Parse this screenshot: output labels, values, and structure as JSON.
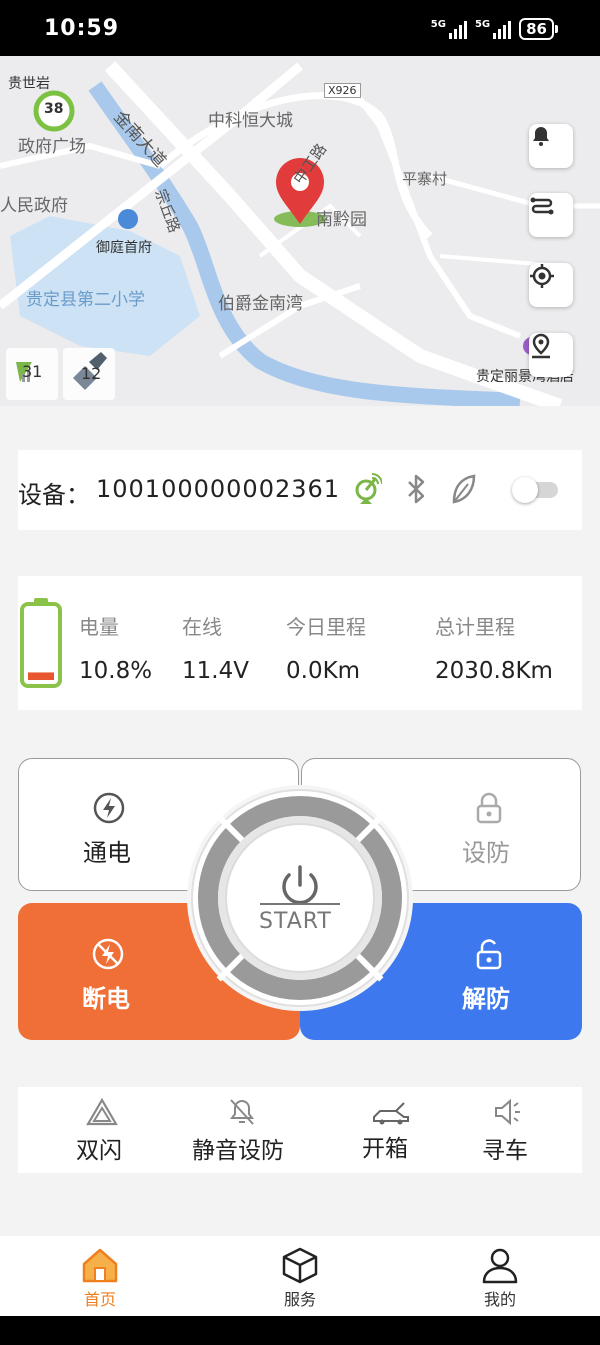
{
  "status_bar": {
    "time": "10:59",
    "sig1": "5G",
    "sig2": "5G",
    "battery": "86"
  },
  "map": {
    "labels": {
      "guishiyan": "贵世岩",
      "zhengfu_guangchang": "政府广场",
      "renmin_zhengfu": "人民政府",
      "jinnan_dadao": "金南大道",
      "zhongke": "中科恒大城",
      "zhonggong_lu": "中工路",
      "nanqian_yuan": "南黔园",
      "pingzhai": "平寨村",
      "zongqiu_lu": "宗丘路",
      "yuting": "御庭首府",
      "school": "贵定县第二小学",
      "bojue": "伯爵金南湾",
      "hotel": "贵定丽景湾酒店",
      "road_code": "X926",
      "route_num": "38"
    },
    "mini_left": "31",
    "mini_right": "12"
  },
  "device": {
    "label": "设备：",
    "id": "100100000002361"
  },
  "stats": {
    "battery_level": 0.108,
    "battery_label": "电量",
    "battery_value": "10.8%",
    "online_label": "在线",
    "online_value": "11.4V",
    "today_label": "今日里程",
    "today_value": "0.0Km",
    "total_label": "总计里程",
    "total_value": "2030.8Km"
  },
  "controls": {
    "power_on": "通电",
    "arm": "设防",
    "power_off": "断电",
    "disarm": "解防",
    "start": "START"
  },
  "quick_actions": {
    "double_flash": "双闪",
    "silent_arm": "静音设防",
    "open_trunk": "开箱",
    "find_car": "寻车"
  },
  "nav": {
    "home": "首页",
    "service": "服务",
    "mine": "我的"
  },
  "colors": {
    "accent": "#ef7f1f",
    "power_off": "#ef6f36",
    "disarm": "#3d78ef",
    "battery_green": "#8bc34a",
    "battery_low": "#e8562f"
  }
}
